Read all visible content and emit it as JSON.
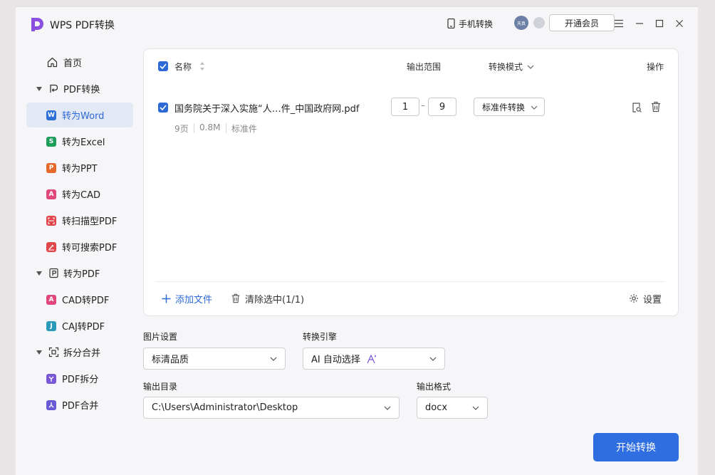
{
  "app": {
    "title": "WPS PDF转换"
  },
  "titlebar": {
    "phone_label": "手机转换",
    "avatar_text": "天真",
    "member_label": "开通会员"
  },
  "sidebar": {
    "home": "首页",
    "pdf_convert": "PDF转换",
    "to_word": "转为Word",
    "to_excel": "转为Excel",
    "to_ppt": "转为PPT",
    "to_cad": "转为CAD",
    "to_scan_pdf": "转扫描型PDF",
    "to_searchable_pdf": "转可搜索PDF",
    "to_pdf": "转为PDF",
    "cad_to_pdf": "CAD转PDF",
    "caj_to_pdf": "CAJ转PDF",
    "split_merge": "拆分合并",
    "pdf_split": "PDF拆分",
    "pdf_merge": "PDF合并",
    "badges": {
      "word": "W",
      "excel": "S",
      "ppt": "P",
      "cad": "A",
      "cad_to_pdf": "A",
      "caj": "J"
    }
  },
  "table": {
    "col_name": "名称",
    "col_range": "输出范围",
    "col_mode": "转换模式",
    "col_action": "操作",
    "file": {
      "name": "国务院关于深入实施“人…件_中国政府网.pdf",
      "range_from": "1",
      "range_sep": "–",
      "range_to": "9",
      "mode": "标准件转换",
      "pages": "9页",
      "size": "0.8M",
      "type": "标准件"
    },
    "add_file": "添加文件",
    "clear_selected": "清除选中(1/1)",
    "settings": "设置"
  },
  "options": {
    "image_label": "图片设置",
    "image_value": "标清品质",
    "engine_label": "转换引擎",
    "engine_value": "AI 自动选择",
    "output_dir_label": "输出目录",
    "output_dir_value": "C:\\Users\\Administrator\\Desktop",
    "format_label": "输出格式",
    "format_value": "docx"
  },
  "start_button": "开始转换",
  "colors": {
    "accent": "#2d6ad6",
    "word": "#2b6fd6",
    "excel": "#1e9e5b",
    "ppt": "#e5672a",
    "cad": "#e0477c",
    "scan": "#e0474c",
    "searchable": "#e0474c",
    "caj": "#2a9ab8",
    "split": "#7a56d6",
    "merge": "#6a5ad6"
  }
}
